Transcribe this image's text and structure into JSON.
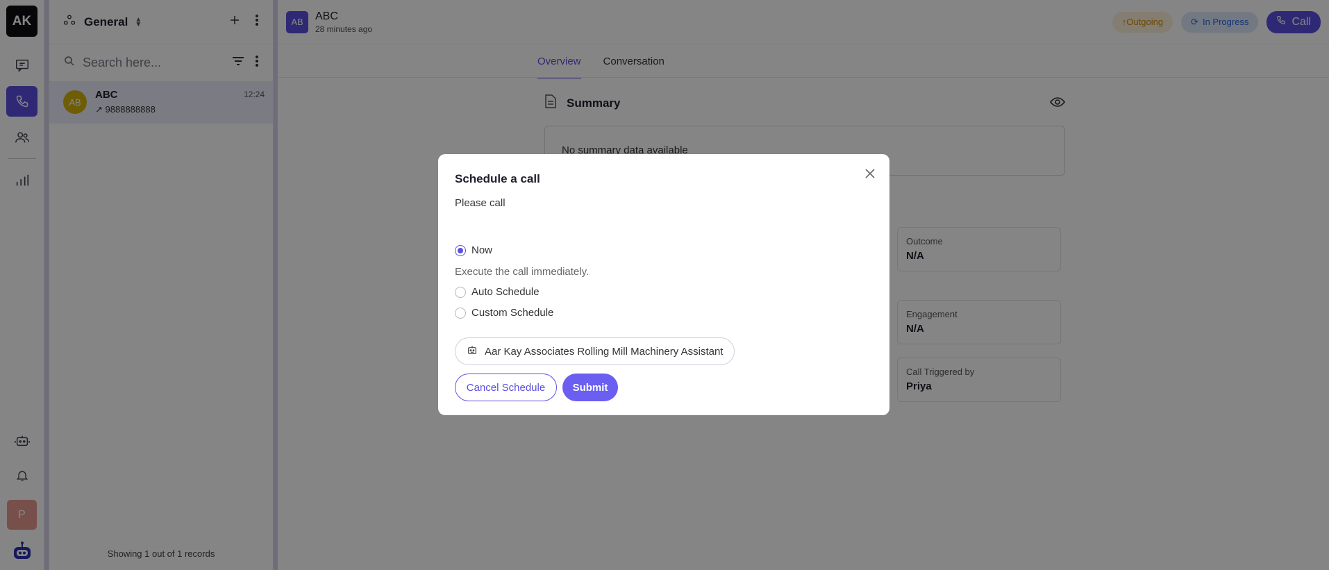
{
  "rail": {
    "workspace_initials": "AK",
    "profile_initial": "P",
    "active_color": "#5b4fe0"
  },
  "list": {
    "title": "General",
    "search_placeholder": "Search here...",
    "items": [
      {
        "initials": "AB",
        "name": "ABC",
        "phone": "9888888888",
        "time": "12:24"
      }
    ],
    "footer": "Showing 1 out of 1 records"
  },
  "header": {
    "initials": "AB",
    "name": "ABC",
    "subtitle": "28 minutes ago",
    "status_outgoing": "Outgoing",
    "status_progress": "In Progress",
    "call_label": "Call"
  },
  "tabs": [
    {
      "label": "Overview",
      "active": true
    },
    {
      "label": "Conversation",
      "active": false
    }
  ],
  "summary": {
    "title": "Summary",
    "empty_text": "No summary data available"
  },
  "cards": [
    {
      "label": "Outcome",
      "value": "N/A"
    },
    {
      "label": "Engagement",
      "value": "N/A"
    },
    {
      "label": "Call Triggered by",
      "value": "Priya"
    }
  ],
  "modal": {
    "title": "Schedule a call",
    "message": "Please call",
    "options": [
      {
        "label": "Now",
        "selected": true
      },
      {
        "label": "Auto Schedule",
        "selected": false
      },
      {
        "label": "Custom Schedule",
        "selected": false
      }
    ],
    "now_description": "Execute the call immediately.",
    "agent_name": "Aar Kay Associates Rolling Mill Machinery Assistant",
    "cancel_label": "Cancel Schedule",
    "submit_label": "Submit"
  }
}
